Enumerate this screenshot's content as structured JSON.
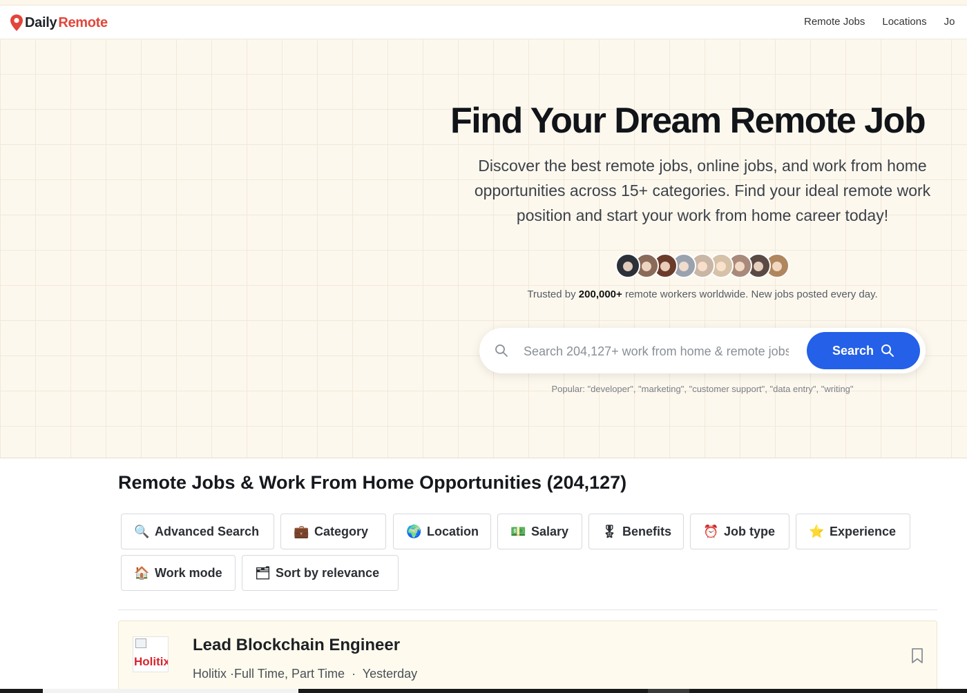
{
  "brand": {
    "name_part1": "Daily",
    "name_part2": "Remote",
    "pin_color": "#e2463a"
  },
  "nav": {
    "links": [
      "Remote Jobs",
      "Locations",
      "Jo"
    ]
  },
  "hero": {
    "title": "Find Your Dream Remote Job",
    "subtitle": "Discover the best remote jobs, online jobs, and work from home opportunities across 15+ categories. Find your ideal remote work position and start your work from home career today!",
    "avatar_colors": [
      "#2c3038",
      "#8a6a58",
      "#6b3b2a",
      "#9aa3ad",
      "#c9b6a4",
      "#d6c2a8",
      "#a98a7a",
      "#5b4a44",
      "#b0865e"
    ],
    "trusted_prefix": "Trusted by",
    "trusted_count": "200,000+",
    "trusted_suffix": "remote workers worldwide. New jobs posted every day."
  },
  "search": {
    "placeholder": "Search 204,127+ work from home & remote jobs...",
    "button_label": "Search",
    "popular": "Popular: \"developer\", \"marketing\", \"customer support\", \"data entry\", \"writing\"",
    "accent": "#2460e8"
  },
  "listing": {
    "title": "Remote Jobs & Work From Home Opportunities (204,127)",
    "filters": [
      {
        "icon": "🔍",
        "label": "Advanced Search"
      },
      {
        "icon": "💼",
        "label": "Category"
      },
      {
        "icon": "🌍",
        "label": "Location"
      },
      {
        "icon": "💵",
        "label": "Salary"
      },
      {
        "icon": "🎖",
        "label": "Benefits"
      },
      {
        "icon": "⏰",
        "label": "Job type"
      },
      {
        "icon": "⭐",
        "label": "Experience"
      },
      {
        "icon": "🏠",
        "label": "Work mode"
      },
      {
        "icon": "🗂",
        "label": "Sort by relevance"
      }
    ]
  },
  "jobs": [
    {
      "logo_alt": "Holitix",
      "title": "Lead Blockchain Engineer",
      "company": "Holitix",
      "type": "·Full Time, Part Time",
      "posted": "Yesterday"
    }
  ]
}
